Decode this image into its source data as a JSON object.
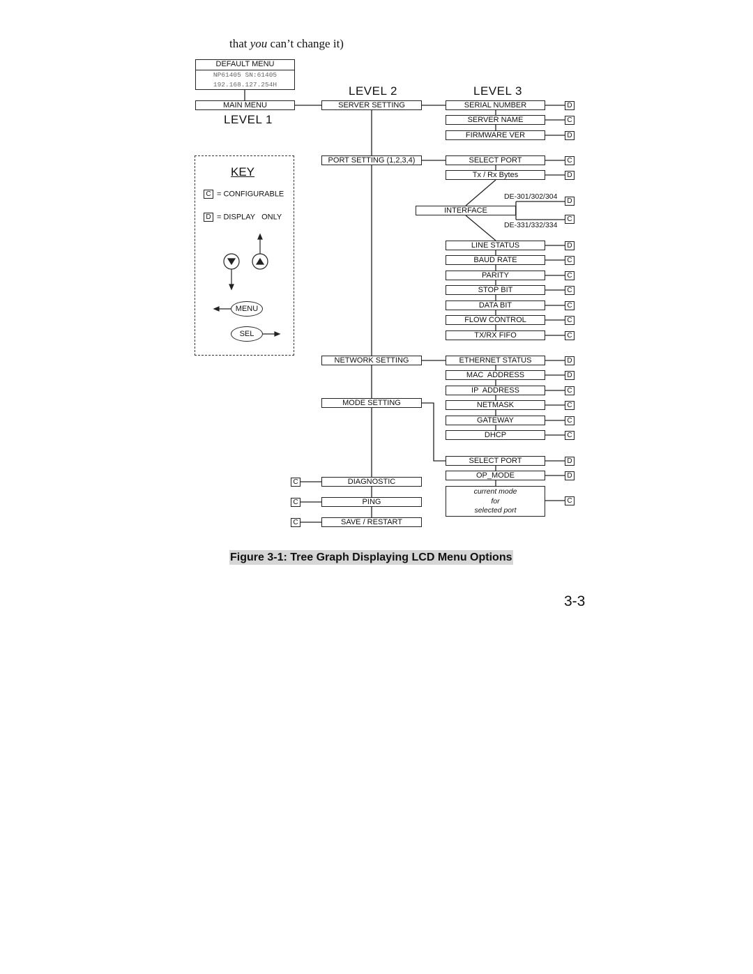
{
  "intro_text": {
    "before": "that ",
    "italic": "you",
    "after": " can’t change it)"
  },
  "default_menu": {
    "title": "DEFAULT MENU",
    "line1": "NP61405 SN:61405",
    "line2": "192.168.127.254H"
  },
  "level_labels": {
    "level1": "LEVEL 1",
    "level2": "LEVEL 2",
    "level3": "LEVEL 3"
  },
  "main_menu": "MAIN MENU",
  "key": {
    "title": "KEY",
    "configurable_badge": "C",
    "configurable_label": "= CONFIGURABLE",
    "display_badge": "D",
    "display_label": "= DISPLAY   ONLY",
    "down_button": "▼",
    "up_button": "▲",
    "menu_button": "MENU",
    "sel_button": "SEL"
  },
  "level2": [
    {
      "label": "SERVER SETTING"
    },
    {
      "label": "PORT SETTING (1,2,3,4)"
    },
    {
      "label": "NETWORK SETTING"
    },
    {
      "label": "MODE SETTING"
    },
    {
      "label": "DIAGNOSTIC",
      "badge": "C"
    },
    {
      "label": "PING",
      "badge": "C"
    },
    {
      "label": "SAVE / RESTART",
      "badge": "C"
    }
  ],
  "server_items": [
    {
      "label": "SERIAL NUMBER",
      "badge": "D"
    },
    {
      "label": "SERVER NAME",
      "badge": "C"
    },
    {
      "label": "FIRMWARE VER",
      "badge": "D"
    }
  ],
  "port_items": [
    {
      "label": "SELECT PORT",
      "badge": "C"
    },
    {
      "label": "Tx / Rx Bytes",
      "badge": "D"
    }
  ],
  "interface": {
    "label": "INTERFACE",
    "variant_a": {
      "models": "DE-301/302/304",
      "badge": "D"
    },
    "variant_b": {
      "models": "DE-331/332/334",
      "badge": "C"
    }
  },
  "port_items_2": [
    {
      "label": "LINE STATUS",
      "badge": "D"
    },
    {
      "label": "BAUD RATE",
      "badge": "C"
    },
    {
      "label": "PARITY",
      "badge": "C"
    },
    {
      "label": "STOP BIT",
      "badge": "C"
    },
    {
      "label": "DATA BIT",
      "badge": "C"
    },
    {
      "label": "FLOW CONTROL",
      "badge": "C"
    },
    {
      "label": "TX/RX FIFO",
      "badge": "C"
    }
  ],
  "network_items": [
    {
      "label": "ETHERNET STATUS",
      "badge": "D"
    },
    {
      "label": "MAC  ADDRESS",
      "badge": "D"
    },
    {
      "label": "IP  ADDRESS",
      "badge": "C"
    },
    {
      "label": "NETMASK",
      "badge": "C"
    },
    {
      "label": "GATEWAY",
      "badge": "C"
    },
    {
      "label": "DHCP",
      "badge": "C"
    }
  ],
  "mode_items": [
    {
      "label": "SELECT PORT",
      "badge": "D"
    },
    {
      "label": "OP_MODE",
      "badge": "D"
    }
  ],
  "mode_current": {
    "line1": "current mode",
    "line2": "for",
    "line3": "selected port",
    "badge": "C"
  },
  "caption": "Figure 3-1: Tree Graph Displaying LCD Menu Options",
  "page_number": "3-3"
}
